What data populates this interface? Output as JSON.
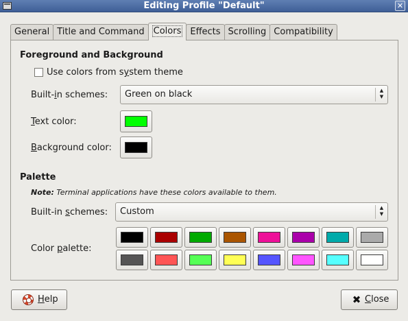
{
  "window": {
    "title": "Editing Profile \"Default\"",
    "close_glyph": "✕"
  },
  "tabs": [
    {
      "label": "General"
    },
    {
      "label": "Title and Command"
    },
    {
      "label": "Colors"
    },
    {
      "label": "Effects"
    },
    {
      "label": "Scrolling"
    },
    {
      "label": "Compatibility"
    }
  ],
  "active_tab": "Colors",
  "fg_bg": {
    "section_title": "Foreground and Background",
    "use_system_label_pre": "Use colors from s",
    "use_system_label_mn": "y",
    "use_system_label_post": "stem theme",
    "use_system_checked": false,
    "schemes_label_pre": "Built-",
    "schemes_label_mn": "i",
    "schemes_label_post": "n schemes:",
    "schemes_value": "Green on black",
    "text_color_label_mn": "T",
    "text_color_label_post": "ext color:",
    "text_color": "#00ff00",
    "bg_color_label_mn": "B",
    "bg_color_label_post": "ackground color:",
    "bg_color": "#000000"
  },
  "palette": {
    "section_title": "Palette",
    "note_bold": "Note:",
    "note_text": " Terminal applications have these colors available to them.",
    "schemes_label_pre": "Built-in ",
    "schemes_label_mn": "s",
    "schemes_label_post": "chemes:",
    "schemes_value": "Custom",
    "palette_label_pre": "Color ",
    "palette_label_mn": "p",
    "palette_label_post": "alette:",
    "row1": [
      "#000000",
      "#aa0000",
      "#00aa00",
      "#aa5500",
      "#ee1199",
      "#aa00aa",
      "#00aaaa",
      "#aaaaaa"
    ],
    "row2": [
      "#555555",
      "#ff5555",
      "#55ff55",
      "#ffff55",
      "#5555ff",
      "#ff55ff",
      "#55ffff",
      "#ffffff"
    ]
  },
  "buttons": {
    "help_mn": "H",
    "help_post": "elp",
    "close_mn": "C",
    "close_post": "lose"
  },
  "icons": {
    "help": "lifebuoy-icon",
    "close": "close-x-icon",
    "combo_arrows": "▲▼"
  }
}
